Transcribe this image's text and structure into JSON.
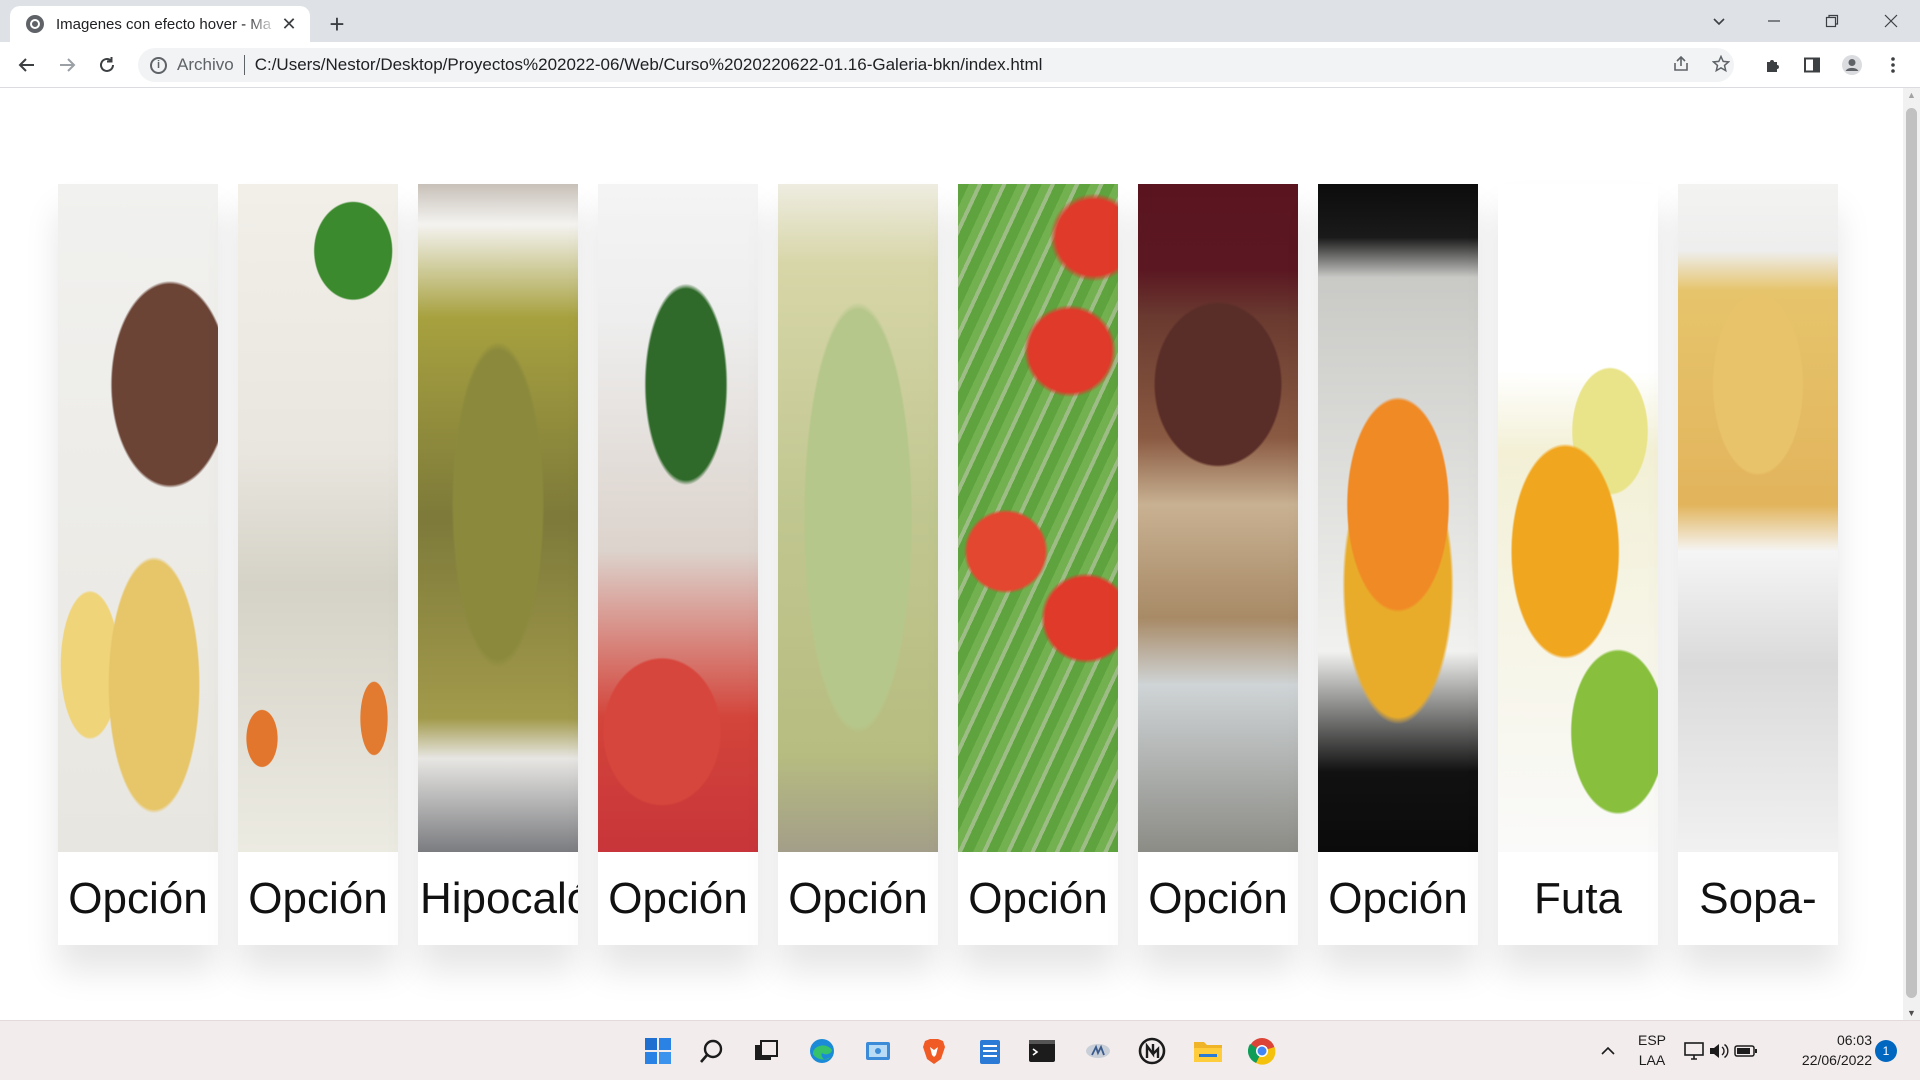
{
  "browser": {
    "tab_title": "Imagenes con efecto hover - Ma",
    "tab_close": "✕",
    "new_tab": "+",
    "address_scheme": "Archivo",
    "address_url": "C:/Users/Nestor/Desktop/Proyectos%202022-06/Web/Curso%2020220622-01.16-Galeria-bkn/index.html",
    "window_controls": {
      "tab_search": "⌄",
      "minimize": "—",
      "restore": "❐",
      "close": "✕"
    }
  },
  "gallery": {
    "items": [
      {
        "caption": "Opción",
        "food": "meat with potatoes"
      },
      {
        "caption": "Opción",
        "food": "rice with creamy sauce"
      },
      {
        "caption": "Hipocaló",
        "food": "zucchini and egg"
      },
      {
        "caption": "Opción",
        "food": "tomato onion salad"
      },
      {
        "caption": "Opción",
        "food": "cabbage salad"
      },
      {
        "caption": "Opción",
        "food": "green beans with tomato"
      },
      {
        "caption": "Opción",
        "food": "bread pudding"
      },
      {
        "caption": "Opción",
        "food": "flan"
      },
      {
        "caption": "Futa",
        "food": "fruit"
      },
      {
        "caption": "Sopa-",
        "food": "noodle soup"
      }
    ]
  },
  "taskbar": {
    "language_top": "ESP",
    "language_bottom": "LAA",
    "time": "06:03",
    "date": "22/06/2022",
    "notification_count": "1",
    "tray_overflow": "^"
  }
}
